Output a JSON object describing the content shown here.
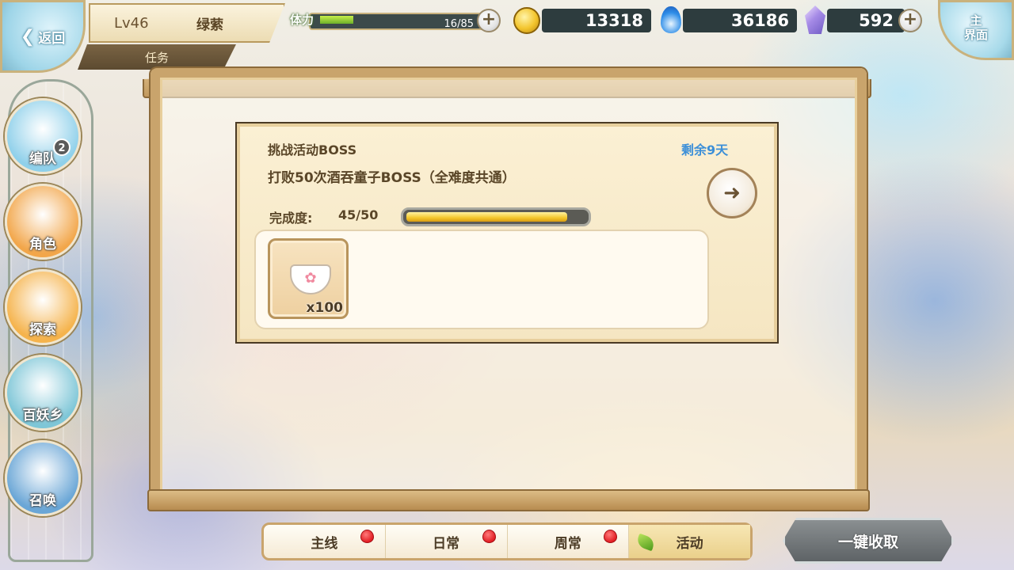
{
  "header": {
    "back_label": "返回",
    "level": "Lv46",
    "player_name": "绿萦",
    "section_title": "任务",
    "stamina_label": "体力",
    "stamina_value": "16/85",
    "stamina_fraction": 0.19,
    "gold": "13318",
    "blue_flame": "36186",
    "crystal": "592",
    "home_label_1": "主",
    "home_label_2": "界面"
  },
  "nav": {
    "items": [
      {
        "label": "编队",
        "icon": "formation-icon",
        "badge": "2",
        "color": "#8fd0ea"
      },
      {
        "label": "角色",
        "icon": "character-icon",
        "color": "#f2a64a"
      },
      {
        "label": "探索",
        "icon": "explore-icon",
        "color": "#f5b34c"
      },
      {
        "label": "百妖乡",
        "icon": "village-icon",
        "color": "#7ec6d7"
      },
      {
        "label": "召唤",
        "icon": "summon-icon",
        "color": "#6aa6d6"
      }
    ]
  },
  "task": {
    "title": "挑战活动BOSS",
    "remaining": "剩余9天",
    "description": "打败50次酒吞童子BOSS（全难度共通）",
    "progress_label": "完成度:",
    "progress_value": "45/50",
    "progress_fraction": 0.9,
    "reward": {
      "icon": "sakura-bowl-icon",
      "quantity": "x100"
    }
  },
  "tabs": [
    {
      "label": "主线",
      "has_alert": true,
      "active": false
    },
    {
      "label": "日常",
      "has_alert": true,
      "active": false
    },
    {
      "label": "周常",
      "has_alert": true,
      "active": false
    },
    {
      "label": "活动",
      "has_alert": false,
      "active": true
    }
  ],
  "collect_all_label": "一键收取",
  "colors": {
    "accent_blue": "#3c8fd8",
    "progress_gold": "#f3c72c",
    "frame_wood": "#c9a46c",
    "alert_red": "#e21e24"
  }
}
